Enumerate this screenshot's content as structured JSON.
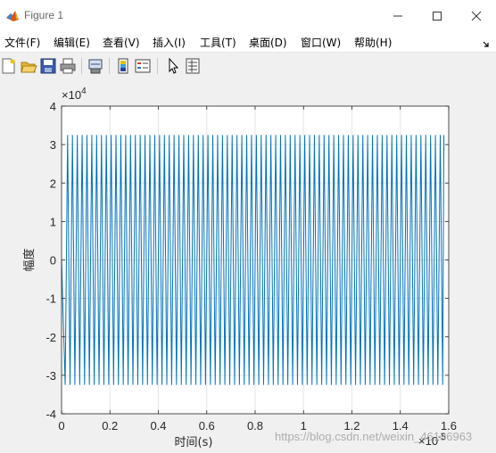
{
  "window": {
    "title": "Figure 1",
    "icon": "matlab-logo-icon"
  },
  "menubar": {
    "items": [
      {
        "label": "文件(F)"
      },
      {
        "label": "编辑(E)"
      },
      {
        "label": "查看(V)"
      },
      {
        "label": "插入(I)"
      },
      {
        "label": "工具(T)"
      },
      {
        "label": "桌面(D)"
      },
      {
        "label": "窗口(W)"
      },
      {
        "label": "帮助(H)"
      }
    ]
  },
  "toolbar": {
    "icons": [
      "new-figure-icon",
      "open-file-icon",
      "save-icon",
      "print-icon",
      "link-plot-icon",
      "insert-colorbar-icon",
      "insert-legend-icon",
      "edit-plot-cursor-icon",
      "property-inspector-icon"
    ]
  },
  "colors": {
    "line": "#0072bd",
    "grid": "#e5e5e5",
    "axes": "#262626"
  },
  "chart_data": {
    "type": "line",
    "title": "",
    "xlabel": "时间(s)",
    "ylabel": "幅度",
    "x_exponent_label": "×10",
    "x_exponent": "-5",
    "y_exponent_label": "×10",
    "y_exponent": "4",
    "xlim": [
      0,
      1.6
    ],
    "ylim": [
      -4,
      4
    ],
    "xticks": [
      "0",
      "0.2",
      "0.4",
      "0.6",
      "0.8",
      "1",
      "1.2",
      "1.4",
      "1.6"
    ],
    "yticks": [
      "4",
      "3",
      "2",
      "1",
      "0",
      "-1",
      "-2",
      "-3",
      "-4"
    ],
    "grid": true,
    "series": [
      {
        "signal": "sine",
        "amplitude": 3.25,
        "x_start": 0,
        "x_end": 1.58,
        "cycles": 79,
        "end_value": 2.85
      }
    ]
  },
  "watermark": "https://blog.csdn.net/weixin_46136963"
}
